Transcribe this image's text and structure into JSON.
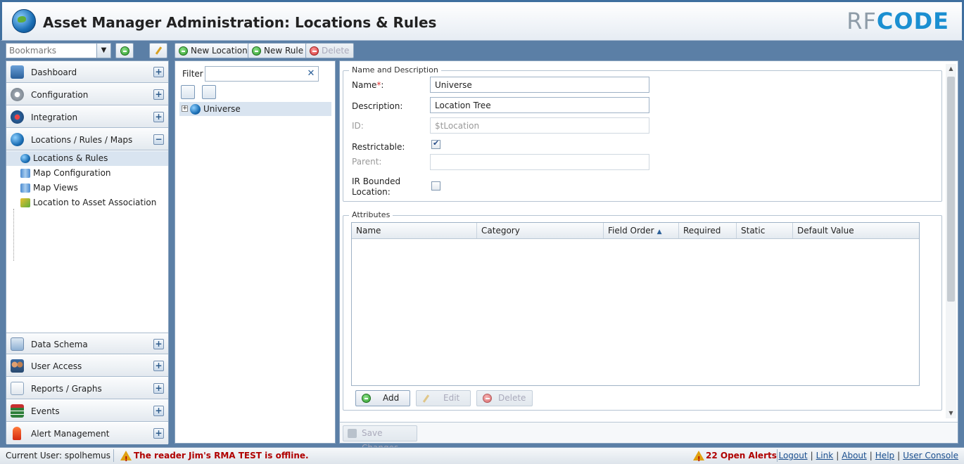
{
  "header": {
    "title": "Asset Manager Administration: Locations & Rules",
    "logo_rf": "RF",
    "logo_code": "CODE"
  },
  "toolbar": {
    "bookmarks_placeholder": "Bookmarks",
    "new_location": "New Location",
    "new_rule": "New Rule",
    "delete": "Delete"
  },
  "nav": {
    "sections_top": [
      {
        "label": "Dashboard",
        "icon": "dashboard-icon"
      },
      {
        "label": "Configuration",
        "icon": "gear-icon"
      },
      {
        "label": "Integration",
        "icon": "integration-icon"
      },
      {
        "label": "Locations / Rules / Maps",
        "icon": "globe-icon"
      }
    ],
    "sub_items": [
      {
        "label": "Locations & Rules",
        "icon": "globe-icon"
      },
      {
        "label": "Map Configuration",
        "icon": "map-icon"
      },
      {
        "label": "Map Views",
        "icon": "map-icon"
      },
      {
        "label": "Location to Asset Association",
        "icon": "association-icon"
      }
    ],
    "sections_bottom": [
      {
        "label": "Data Schema",
        "icon": "schema-icon"
      },
      {
        "label": "User Access",
        "icon": "users-icon"
      },
      {
        "label": "Reports / Graphs",
        "icon": "report-icon"
      },
      {
        "label": "Events",
        "icon": "events-icon"
      },
      {
        "label": "Alert Management",
        "icon": "alert-icon"
      }
    ]
  },
  "tree": {
    "filter_label": "Filter",
    "filter_value": "",
    "root_node": "Universe"
  },
  "form": {
    "name_desc_legend": "Name and Description",
    "name_label": "Name",
    "name_value": "Universe",
    "description_label": "Description:",
    "description_value": "Location Tree",
    "id_label": "ID:",
    "id_value": "$tLocation",
    "restrictable_label": "Restrictable:",
    "restrictable_checked": true,
    "parent_label": "Parent:",
    "parent_value": "",
    "ir_bounded_label_1": "IR Bounded",
    "ir_bounded_label_2": "Location:",
    "ir_bounded_checked": false,
    "attributes_legend": "Attributes",
    "columns": [
      "Name",
      "Category",
      "Field Order",
      "Required",
      "Static",
      "Default Value"
    ],
    "add": "Add",
    "edit": "Edit",
    "delete": "Delete",
    "save_changes": "Save Changes"
  },
  "status": {
    "current_user": "Current User: spolhemus",
    "message": "The reader Jim's RMA TEST is offline.",
    "alerts": "22 Open Alerts",
    "links": [
      "Logout",
      "Link",
      "About",
      "Help",
      "User Console"
    ]
  },
  "colors": {
    "frame": "#3f6f9f",
    "accent_blue": "#1b8fd1",
    "error_red": "#b00000",
    "selection": "#d9e4f0"
  }
}
